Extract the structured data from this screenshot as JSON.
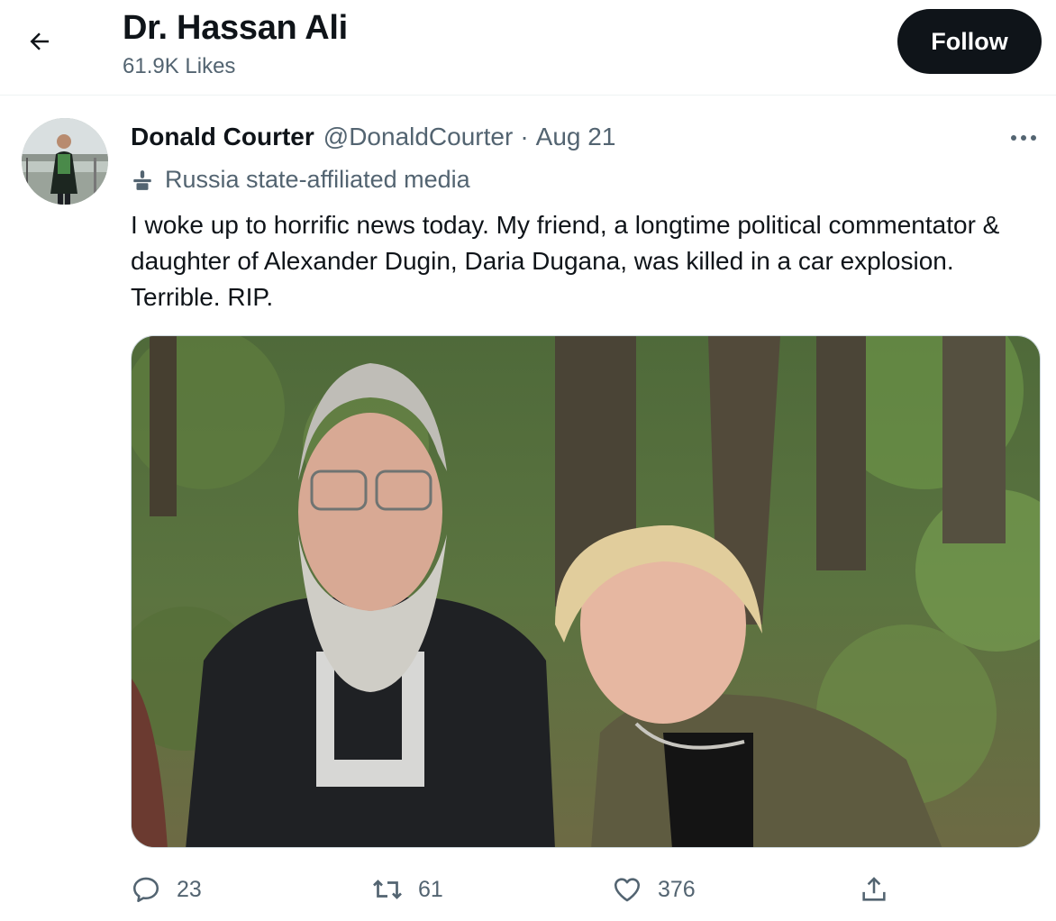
{
  "header": {
    "back_icon": "arrow-left-icon",
    "title": "Dr. Hassan Ali",
    "subtitle": "61.9K Likes",
    "follow_label": "Follow"
  },
  "tweet": {
    "author_name": "Donald Courter",
    "author_handle": "@DonaldCourter",
    "separator": "·",
    "date": "Aug 21",
    "more_icon": "more-horizontal-icon",
    "label_icon": "podium-icon",
    "label": "Russia state-affiliated media",
    "text": "I woke up to horrific news today. My friend, a longtime political commentator & daughter of Alexander Dugin, Daria Dugana, was killed in a car explosion. Terrible. RIP.",
    "media_icon": "photo-image-icon"
  },
  "actions": {
    "reply_count": "23",
    "retweet_count": "61",
    "like_count": "376",
    "reply_icon": "reply-bubble-icon",
    "retweet_icon": "retweet-icon",
    "like_icon": "heart-icon",
    "share_icon": "share-icon"
  },
  "colors": {
    "text_primary": "#0f1419",
    "text_secondary": "#536471",
    "follow_bg": "#0f1419",
    "border": "#eff3f4"
  }
}
